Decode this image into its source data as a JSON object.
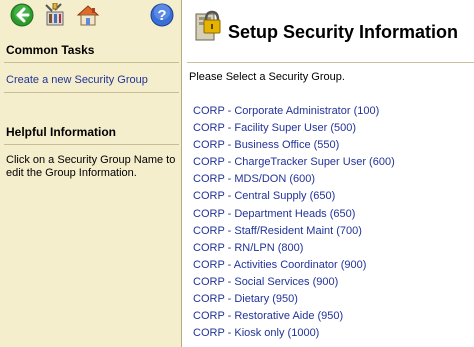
{
  "toolbar": {
    "back_icon": "back-arrow-icon",
    "tools_icon": "tools-icon",
    "home_icon": "home-icon",
    "help_icon": "help-icon",
    "help_glyph": "?"
  },
  "sidebar": {
    "common_tasks_title": "Common Tasks",
    "create_link": "Create a new Security Group",
    "helpful_info_title": "Helpful Information",
    "help_text": "Click on a Security Group Name to edit the Group Information."
  },
  "main": {
    "title_icon": "security-lock-icon",
    "title": "Setup Security Information",
    "prompt": "Please Select a Security Group.",
    "groups": [
      "CORP - Corporate Administrator (100)",
      "CORP - Facility Super User (500)",
      "CORP - Business Office (550)",
      "CORP - ChargeTracker Super User (600)",
      "CORP - MDS/DON (600)",
      "CORP - Central Supply (650)",
      "CORP - Department Heads (650)",
      "CORP - Staff/Resident Maint (700)",
      "CORP - RN/LPN (800)",
      "CORP - Activities Coordinator (900)",
      "CORP - Social Services (900)",
      "CORP - Dietary (950)",
      "CORP - Restorative Aide (950)",
      "CORP - Kiosk only (1000)"
    ]
  },
  "colors": {
    "sidebar_bg": "#f5eecd",
    "link": "#223399",
    "back_green": "#2e9a2e",
    "help_blue": "#3a6fd8"
  }
}
